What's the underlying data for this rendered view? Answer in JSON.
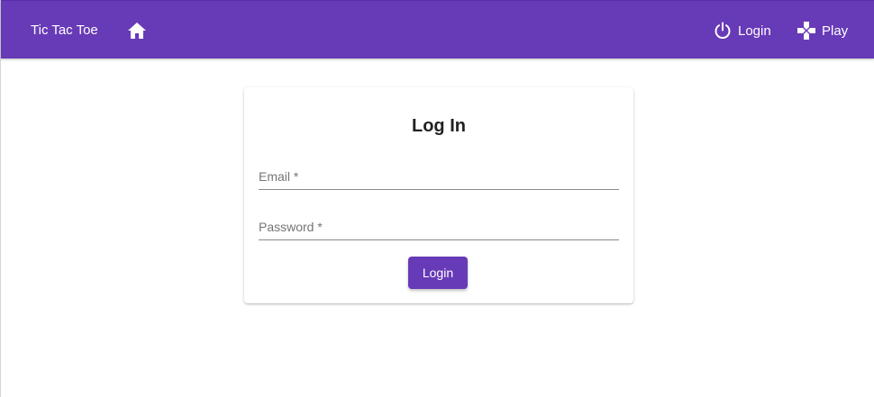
{
  "colors": {
    "accent": "#673ab7",
    "text_on_accent": "#ffffff"
  },
  "header": {
    "brand": "Tic Tac Toe",
    "home_icon": "home-icon",
    "nav": [
      {
        "label": "Login",
        "icon": "power-icon"
      },
      {
        "label": "Play",
        "icon": "gamepad-icon"
      }
    ]
  },
  "login_card": {
    "title": "Log In",
    "email_placeholder": "Email *",
    "password_placeholder": "Password *",
    "submit_label": "Login"
  }
}
